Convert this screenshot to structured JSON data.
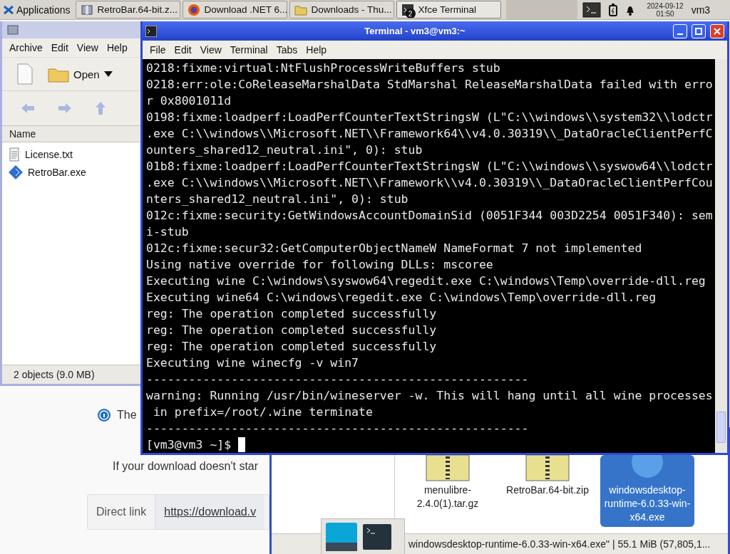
{
  "panel": {
    "applications": "Applications",
    "tasks": [
      {
        "label": "RetroBar.64-bit.z...",
        "kind": "archive",
        "selected": false
      },
      {
        "label": "Download .NET 6...",
        "kind": "browser",
        "selected": false
      },
      {
        "label": "Downloads - Thu...",
        "kind": "folder",
        "selected": false
      },
      {
        "label": "Xfce Terminal",
        "kind": "terminal",
        "selected": true,
        "badge": "2"
      }
    ],
    "clock": {
      "date": "2024-09-12",
      "time": "01:50"
    },
    "user": "vm3"
  },
  "browser": {
    "notice": "The",
    "download_hint": "If your download doesn't star",
    "direct_link": {
      "label": "Direct link",
      "url": "https://download.v"
    }
  },
  "archive_window": {
    "menu": [
      "Archive",
      "Edit",
      "View",
      "Help"
    ],
    "open": "Open",
    "column": "Name",
    "files": [
      {
        "name": "License.txt",
        "kind": "text"
      },
      {
        "name": "RetroBar.exe",
        "kind": "exe"
      }
    ],
    "status": "2 objects (9.0 MB)"
  },
  "file_manager": {
    "items": [
      {
        "name": "menulibre-2.4.0(1).tar.gz",
        "selected": false
      },
      {
        "name": "RetroBar.64-bit.zip",
        "selected": false
      },
      {
        "name": "windowsdesktop-runtime-6.0.33-win-x64.exe",
        "selected": true
      }
    ],
    "status": "windowsdesktop-runtime-6.0.33-win-x64.exe\" | 55.1 MiB (57,805,1..."
  },
  "terminal": {
    "title": "Terminal - vm3@vm3:~",
    "menu": [
      "File",
      "Edit",
      "View",
      "Terminal",
      "Tabs",
      "Help"
    ],
    "lines": [
      "0218:fixme:virtual:NtFlushProcessWriteBuffers stub",
      "0218:err:ole:CoReleaseMarshalData StdMarshal ReleaseMarshalData failed with erro",
      "r 0x8001011d",
      "0198:fixme:loadperf:LoadPerfCounterTextStringsW (L\"C:\\\\windows\\\\system32\\\\lodctr",
      ".exe C:\\\\windows\\\\Microsoft.NET\\\\Framework64\\\\v4.0.30319\\\\_DataOracleClientPerfC",
      "ounters_shared12_neutral.ini\", 0): stub",
      "01b8:fixme:loadperf:LoadPerfCounterTextStringsW (L\"C:\\\\windows\\\\syswow64\\\\lodctr",
      ".exe C:\\\\windows\\\\Microsoft.NET\\\\Framework\\\\v4.0.30319\\\\_DataOracleClientPerfCou",
      "nters_shared12_neutral.ini\", 0): stub",
      "012c:fixme:security:GetWindowsAccountDomainSid (0051F344 003D2254 0051F340): sem",
      "i-stub",
      "012c:fixme:secur32:GetComputerObjectNameW NameFormat 7 not implemented",
      "Using native override for following DLLs: mscoree",
      "Executing wine C:\\windows\\syswow64\\regedit.exe C:\\windows\\Temp\\override-dll.reg",
      "Executing wine64 C:\\windows\\regedit.exe C:\\windows\\Temp\\override-dll.reg",
      "reg: The operation completed successfully",
      "reg: The operation completed successfully",
      "reg: The operation completed successfully",
      "Executing wine winecfg -v win7",
      "------------------------------------------------------",
      "warning: Running /usr/bin/wineserver -w. This will hang until all wine processes",
      " in prefix=/root/.wine terminate",
      "------------------------------------------------------"
    ],
    "prompt": "[vm3@vm3 ~]$"
  }
}
